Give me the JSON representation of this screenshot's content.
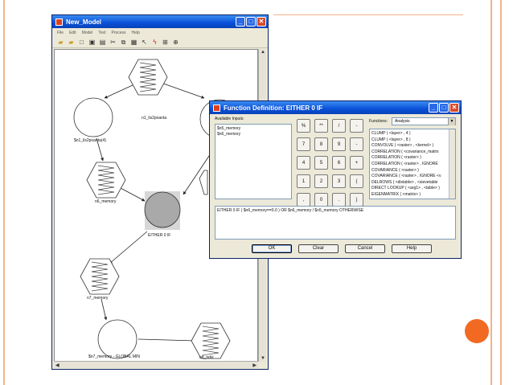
{
  "main_window": {
    "title": "New_Model",
    "menu": [
      "File",
      "Edit",
      "Model",
      "Text",
      "Process",
      "Help"
    ],
    "controls": {
      "minimize": "_",
      "maximize": "□",
      "close": "✕"
    }
  },
  "toolbar_icons": [
    "open-folder-icon",
    "open-file-icon",
    "new-file-icon",
    "save-icon",
    "print-icon",
    "cut-icon",
    "copy-icon",
    "paste-icon",
    "pointer-icon",
    "connect-icon",
    "grid-icon",
    "zoom-icon"
  ],
  "diagram": {
    "labels": {
      "n1_lis2poanta": "n1_lis2poanta",
      "n1_circle": "$n1_lis2poanta(4)",
      "n6_memory": "n6_memory",
      "either": "EITHER 0 IF",
      "n7_memory": "n7_memory",
      "n7_global": "$n7_memory - GLOBAL MIN",
      "n8_ndvi": "n8_ndvi"
    }
  },
  "dialog": {
    "title": "Function Definition:  EITHER 0 IF",
    "available_inputs_label": "Available Inputs:",
    "inputs": [
      "$n5_memory",
      "$n6_memory"
    ],
    "functions_label": "Functions:",
    "functions_selected": "Analysis",
    "functions": [
      "CLUMP ( <layer> , 4 )",
      "CLUMP ( <layer> , 8 )",
      "CONVOLVE ( <raster> , <kernel> )",
      "CORRELATION ( <covariance_matrix",
      "CORRELATION ( <raster> )",
      "CORRELATION ( <raster> , IGNORE",
      "COVARIANCE ( <raster> )",
      "COVARIANCE ( <raster> , IGNORE <v",
      "DELROWS ( <distable> , <sievetable",
      "DIRECT LOOKUP ( <arg1> , <table> )",
      "EIGENMATRIX ( <matrix> )"
    ],
    "keypad": [
      "%",
      "**",
      "/",
      "-",
      "7",
      "8",
      "9",
      "-",
      "4",
      "5",
      "6",
      "+",
      "1",
      "2",
      "3",
      "(",
      ",",
      "0",
      ".",
      ")"
    ],
    "expression": "EITHER 0 IF ( $n6_memory==0.0 ) OR $n6_memory / $n5_memory OTHERWISE",
    "buttons": {
      "ok": "OK",
      "clear": "Clear",
      "cancel": "Cancel",
      "help": "Help"
    },
    "controls": {
      "minimize": "_",
      "maximize": "□",
      "close": "✕"
    }
  },
  "colors": {
    "accent_orange": "#f26a22",
    "slide_line": "#f3b38a",
    "titlebar_blue": "#0a50d8",
    "selected_node": "#a9a9a9"
  }
}
